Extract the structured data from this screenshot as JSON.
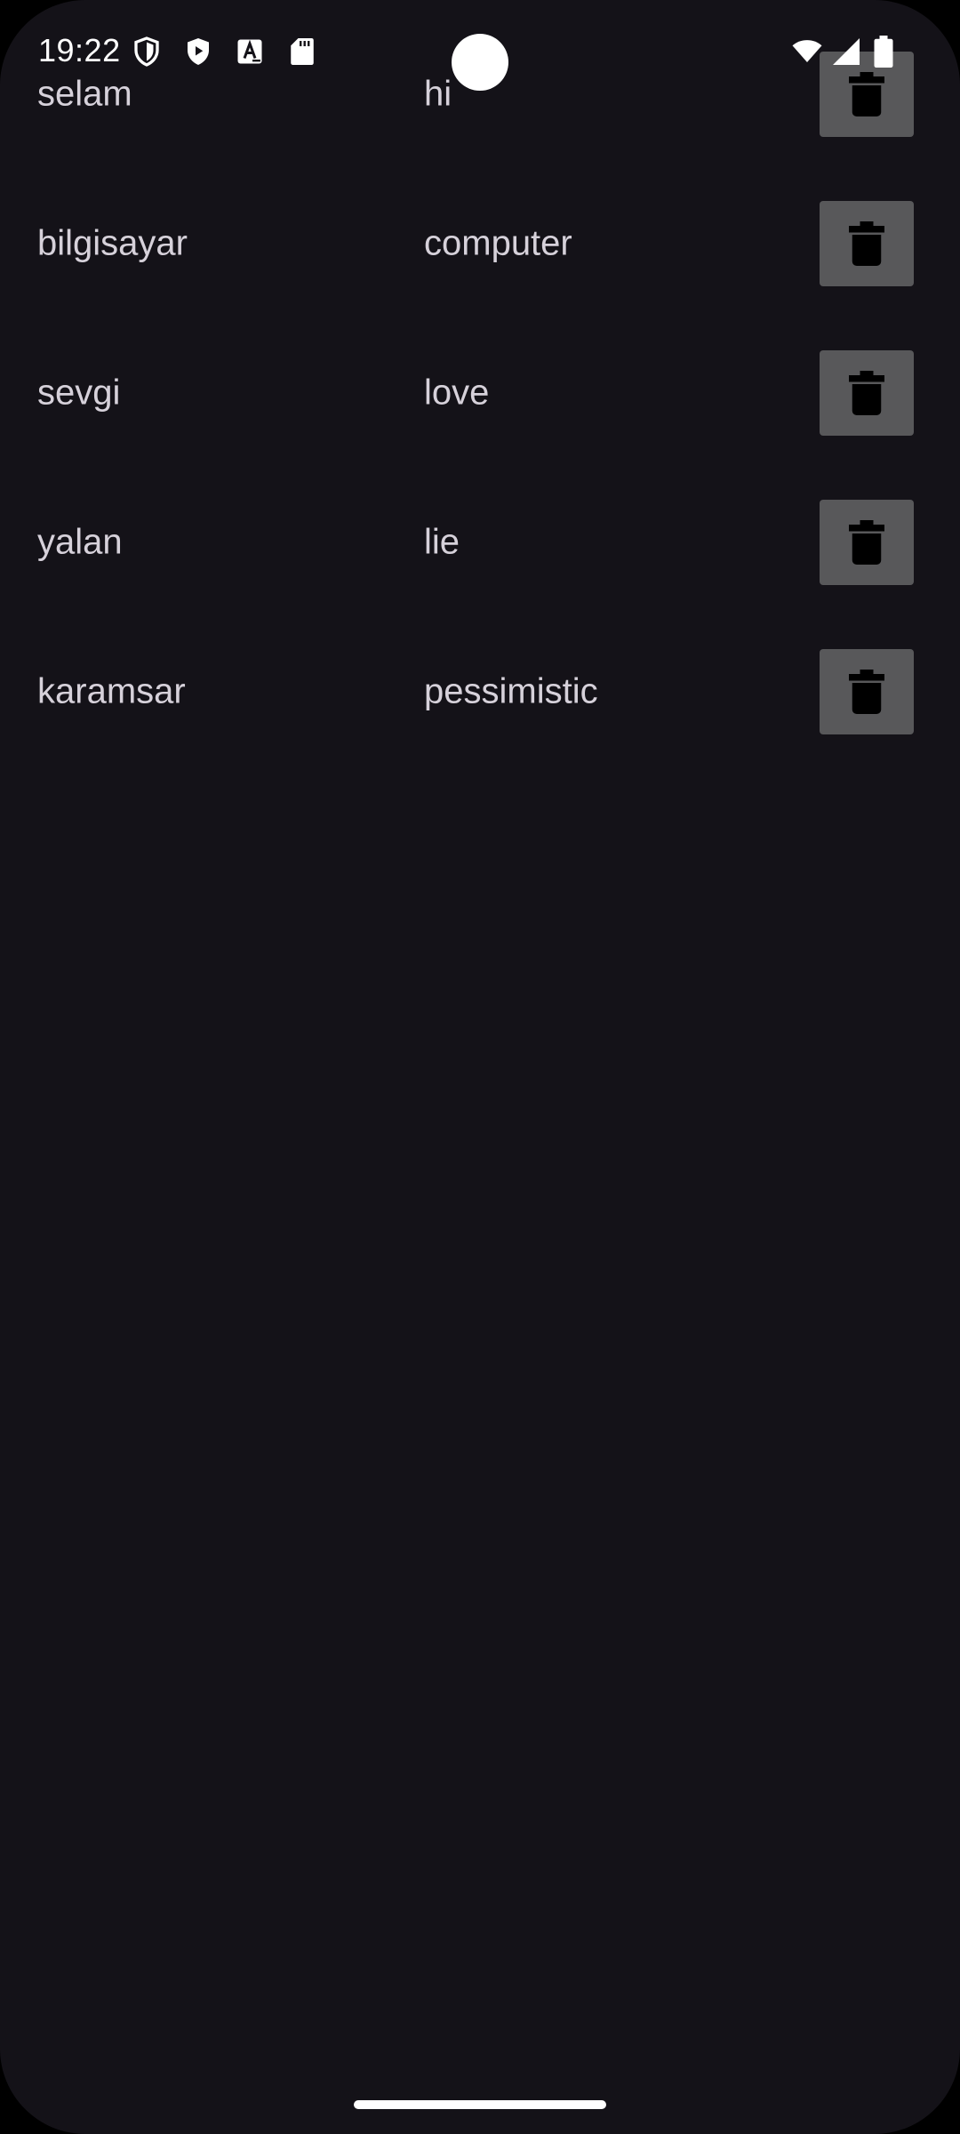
{
  "status_bar": {
    "time": "19:22",
    "left_icons": [
      "shield-outline-icon",
      "play-protect-icon",
      "text-a-icon",
      "sd-card-icon"
    ],
    "right_icons": [
      "wifi-icon",
      "signal-icon",
      "battery-icon"
    ]
  },
  "words": [
    {
      "term": "selam",
      "translation": "hi"
    },
    {
      "term": "bilgisayar",
      "translation": "computer"
    },
    {
      "term": "sevgi",
      "translation": "love"
    },
    {
      "term": "yalan",
      "translation": "lie"
    },
    {
      "term": "karamsar",
      "translation": "pessimistic"
    }
  ],
  "row_action_icon": "trash-icon",
  "colors": {
    "background": "#141218",
    "text": "#d6d1da",
    "delete_button": "#58585a"
  }
}
